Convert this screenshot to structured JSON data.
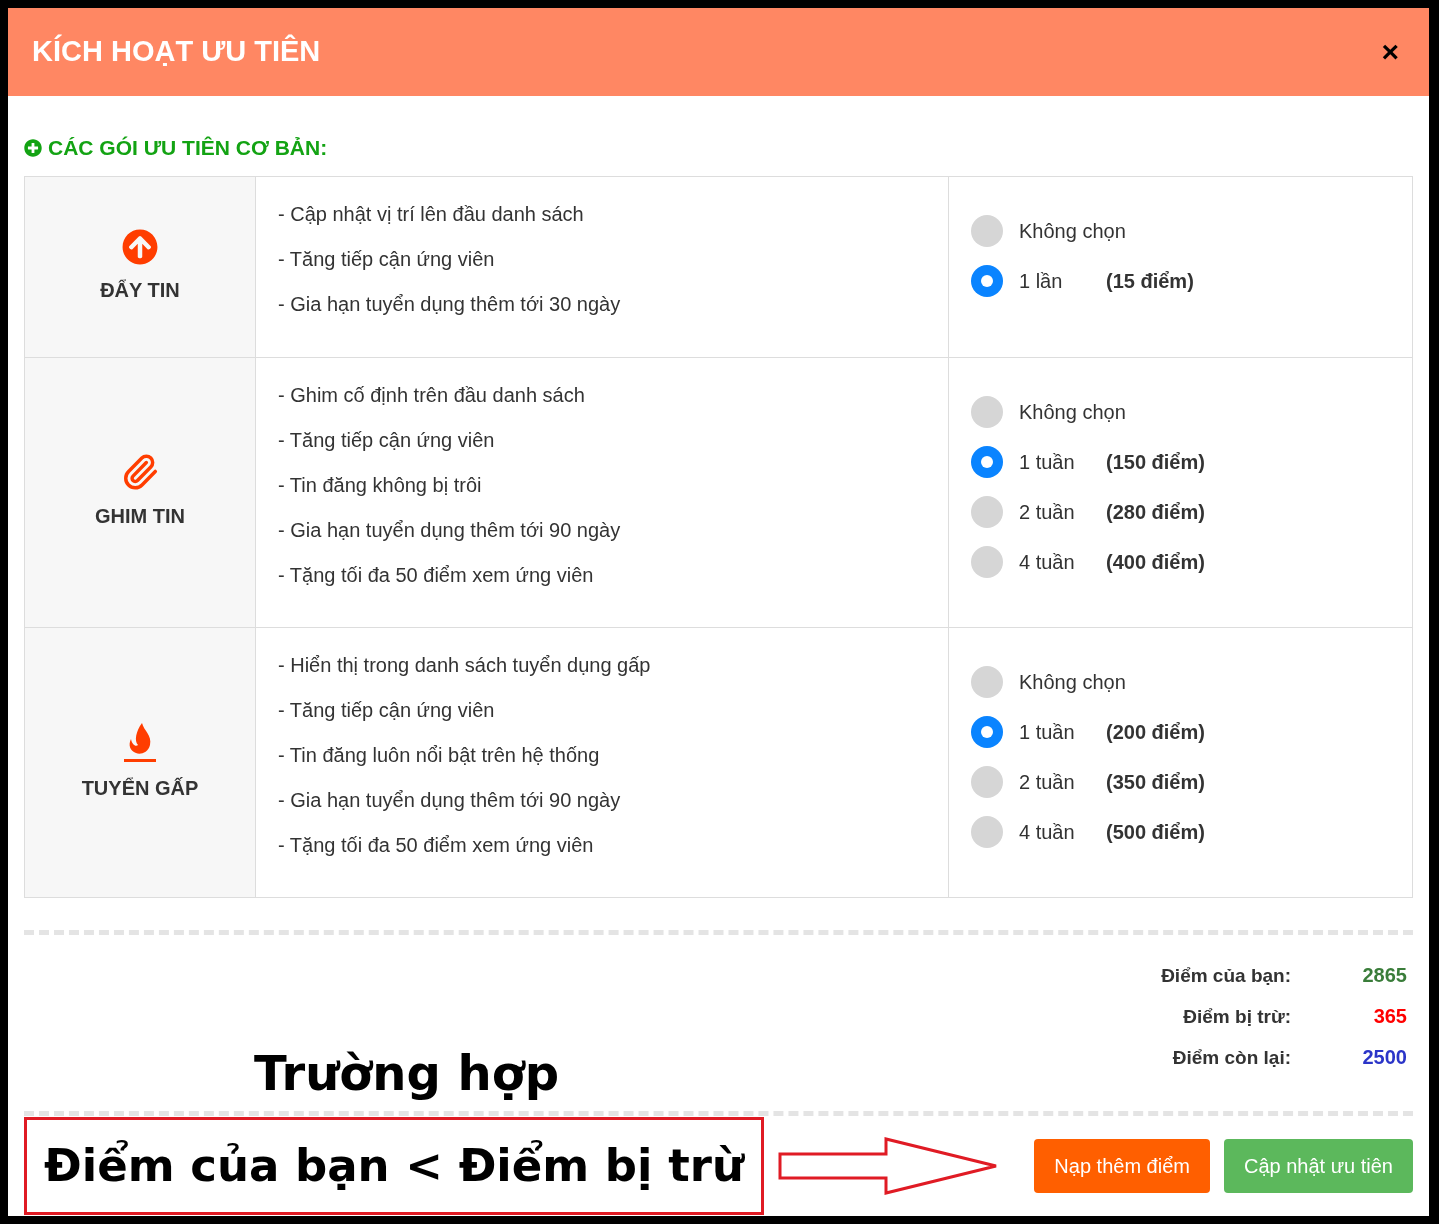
{
  "dialog": {
    "title": "KÍCH HOẠT ƯU TIÊN",
    "close": "×"
  },
  "section_title": "CÁC GÓI ƯU TIÊN CƠ BẢN:",
  "packages": [
    {
      "kind": "push",
      "name": "ĐẨY TIN",
      "features": [
        "- Cập nhật vị trí lên đầu danh sách",
        "- Tăng tiếp cận ứng viên",
        "- Gia hạn tuyển dụng thêm tới 30 ngày"
      ],
      "options": [
        {
          "label": "Không chọn",
          "selected": false
        },
        {
          "label": "1 lần",
          "price": "(15 điểm)",
          "selected": true
        }
      ]
    },
    {
      "kind": "pin",
      "name": "GHIM TIN",
      "features": [
        "- Ghim cố định trên đầu danh sách",
        "- Tăng tiếp cận ứng viên",
        "- Tin đăng không bị trôi",
        "- Gia hạn tuyển dụng thêm tới 90 ngày",
        "- Tặng tối đa 50 điểm xem ứng viên"
      ],
      "options": [
        {
          "label": "Không chọn",
          "selected": false
        },
        {
          "label": "1 tuần",
          "price": "(150 điểm)",
          "selected": true
        },
        {
          "label": "2 tuần",
          "price": "(280 điểm)",
          "selected": false
        },
        {
          "label": "4 tuần",
          "price": "(400 điểm)",
          "selected": false
        }
      ]
    },
    {
      "kind": "urgent",
      "name": "TUYỂN GẤP",
      "features": [
        "- Hiển thị trong danh sách tuyển dụng gấp",
        "- Tăng tiếp cận ứng viên",
        "- Tin đăng luôn nổi bật trên hệ thống",
        "- Gia hạn tuyển dụng thêm tới 90 ngày",
        "- Tặng tối đa 50 điểm xem ứng viên"
      ],
      "options": [
        {
          "label": "Không chọn",
          "selected": false
        },
        {
          "label": "1 tuần",
          "price": "(200 điểm)",
          "selected": true
        },
        {
          "label": "2 tuần",
          "price": "(350 điểm)",
          "selected": false
        },
        {
          "label": "4 tuần",
          "price": "(500 điểm)",
          "selected": false
        }
      ]
    }
  ],
  "summary": [
    {
      "label": "Điểm của bạn:",
      "value": "2865",
      "color": "#3a7d3a"
    },
    {
      "label": "Điểm bị trừ:",
      "value": "365",
      "color": "#ff0000"
    },
    {
      "label": "Điểm còn lại:",
      "value": "2500",
      "color": "#2b35c8"
    }
  ],
  "annotation": {
    "heading": "Trường hợp",
    "condition": "Điểm của bạn < Điểm bị trừ"
  },
  "buttons": [
    {
      "kind": "topup",
      "label": "Nạp thêm điểm"
    },
    {
      "kind": "update",
      "label": "Cập nhật ưu tiên"
    }
  ]
}
